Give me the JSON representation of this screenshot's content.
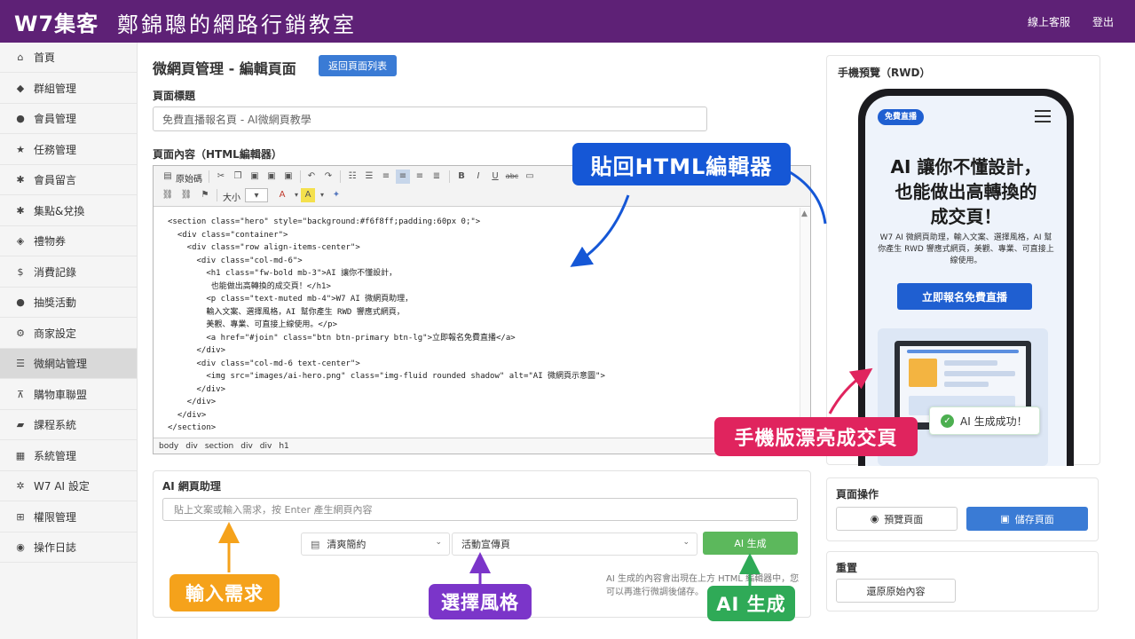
{
  "header": {
    "brand": "W7集客",
    "subtitle": "鄭錦聰的網路行銷教室",
    "support_link": "線上客服",
    "logout_link": "登出"
  },
  "sidebar": {
    "items": [
      {
        "label": "首頁",
        "icon": "home-icon"
      },
      {
        "label": "群組管理",
        "icon": "tags-icon"
      },
      {
        "label": "會員管理",
        "icon": "user-icon"
      },
      {
        "label": "任務管理",
        "icon": "star-icon"
      },
      {
        "label": "會員留言",
        "icon": "asterisk-icon"
      },
      {
        "label": "集點&兌換",
        "icon": "asterisk-icon"
      },
      {
        "label": "禮物券",
        "icon": "ticket-icon"
      },
      {
        "label": "消費記錄",
        "icon": "dollar-icon"
      },
      {
        "label": "抽獎活動",
        "icon": "apple-icon"
      },
      {
        "label": "商家設定",
        "icon": "gear-icon"
      },
      {
        "label": "微網站管理",
        "icon": "list-icon"
      },
      {
        "label": "購物車聯盟",
        "icon": "cart-icon"
      },
      {
        "label": "課程系統",
        "icon": "book-icon"
      },
      {
        "label": "系統管理",
        "icon": "grid-icon"
      },
      {
        "label": "W7 AI 設定",
        "icon": "network-icon"
      },
      {
        "label": "權限管理",
        "icon": "sitemap-icon"
      },
      {
        "label": "操作日誌",
        "icon": "record-icon"
      }
    ],
    "active_index": 10
  },
  "main": {
    "title": "微網頁管理 - 編輯頁面",
    "back_button": "返回頁面列表",
    "page_title_label": "頁面標題",
    "page_title_value": "免費直播報名頁 - AI微網頁教學",
    "content_label": "頁面內容（HTML編輯器）",
    "toolbar": {
      "source_label": "原始碼",
      "size_label": "大小"
    },
    "code": "<section class=\"hero\" style=\"background:#f6f8ff;padding:60px 0;\">\n  <div class=\"container\">\n    <div class=\"row align-items-center\">\n      <div class=\"col-md-6\">\n        <h1 class=\"fw-bold mb-3\">AI 讓你不懂設計，\n         也能做出高轉換的成交頁！</h1>\n        <p class=\"text-muted mb-4\">W7 AI 微網頁助理，\n        輸入文案、選擇風格，AI 幫你產生 RWD 響應式網頁，\n        美觀、專業、可直接上線使用。</p>\n        <a href=\"#join\" class=\"btn btn-primary btn-lg\">立即報名免費直播</a>\n      </div>\n      <div class=\"col-md-6 text-center\">\n        <img src=\"images/ai-hero.png\" class=\"img-fluid rounded shadow\" alt=\"AI 微網頁示意圖\">\n      </div>\n    </div>\n  </div>\n</section>",
    "path": [
      "body",
      "div",
      "section",
      "div",
      "div",
      "h1"
    ]
  },
  "ai": {
    "title": "AI 網頁助理",
    "input_placeholder": "貼上文案或輸入需求，按 Enter 產生網頁內容",
    "style_select": "清爽簡約",
    "type_select": "活動宣傳頁",
    "generate_button": "AI 生成",
    "note": "AI 生成的內容會出現在上方 HTML 編輯器中，您可以再進行微調後儲存。"
  },
  "preview": {
    "title": "手機預覽（RWD）",
    "badge": "免費直播",
    "headline_1": "AI 讓你不懂設計，",
    "headline_2": "也能做出高轉換的",
    "headline_3": "成交頁！",
    "paragraph": "W7 AI 微網頁助理，輸入文案、選擇風格，AI 幫你產生 RWD 響應式網頁，美觀、專業、可直接上線使用。",
    "cta": "立即報名免費直播",
    "toast": "AI 生成成功！"
  },
  "operations": {
    "title": "頁面操作",
    "preview_button": "預覽頁面",
    "save_button": "儲存頁面"
  },
  "reset": {
    "title": "重置",
    "restore_button": "還原原始內容"
  },
  "callouts": {
    "paste": "貼回HTML編輯器",
    "mobile": "手機版漂亮成交頁",
    "input": "輸入需求",
    "style": "選擇風格",
    "generate": "AI 生成"
  },
  "colors": {
    "header": "#5e2176",
    "primary": "#3a7bd5",
    "success": "#5cb85c",
    "callout_blue": "#1557d6",
    "callout_red": "#e0245e",
    "callout_orange": "#f5a21b",
    "callout_purple": "#7b35c9",
    "callout_green": "#2faa57"
  }
}
